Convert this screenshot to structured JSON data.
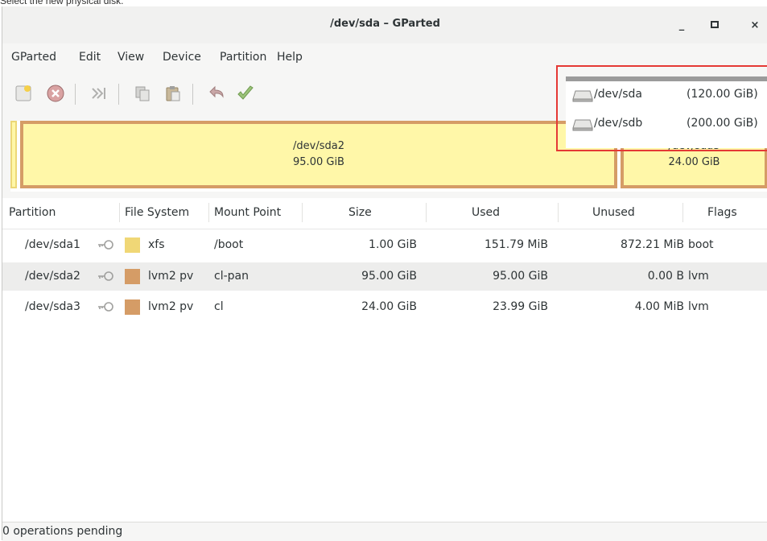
{
  "instruction": "Select the new physical disk.",
  "window": {
    "title": "/dev/sda – GParted",
    "minimize_label": "_",
    "maximize_label": "□",
    "close_label": "×"
  },
  "menu": [
    "GParted",
    "Edit",
    "View",
    "Device",
    "Partition",
    "Help"
  ],
  "toolbar": {
    "icons": [
      "new-partition-icon",
      "delete-icon",
      "resize-move-icon",
      "copy-icon",
      "paste-icon",
      "undo-icon",
      "apply-icon"
    ]
  },
  "disk_map": {
    "segments": [
      {
        "name": "/dev/sda2",
        "size": "95.00 GiB"
      },
      {
        "name": "/dev/sda3",
        "size": "24.00 GiB"
      }
    ],
    "colors": {
      "xfs": "#f0d776",
      "lvm": "#d59c66",
      "fill": "#fff7a8"
    }
  },
  "device_dropdown": {
    "items": [
      {
        "name": "/dev/sda",
        "size": "(120.00 GiB)"
      },
      {
        "name": "/dev/sdb",
        "size": "(200.00 GiB)"
      }
    ],
    "highlight_color": "#e53935"
  },
  "table": {
    "headers": [
      "Partition",
      "File System",
      "Mount Point",
      "Size",
      "Used",
      "Unused",
      "Flags"
    ],
    "rows": [
      {
        "partition": "/dev/sda1",
        "fs": "xfs",
        "fs_color": "#f0d776",
        "mount": "/boot",
        "size": "1.00 GiB",
        "used": "151.79 MiB",
        "unused": "872.21 MiB",
        "flags": "boot"
      },
      {
        "partition": "/dev/sda2",
        "fs": "lvm2 pv",
        "fs_color": "#d59c66",
        "mount": "cl-pan",
        "size": "95.00 GiB",
        "used": "95.00 GiB",
        "unused": "0.00 B",
        "flags": "lvm"
      },
      {
        "partition": "/dev/sda3",
        "fs": "lvm2 pv",
        "fs_color": "#d59c66",
        "mount": "cl",
        "size": "24.00 GiB",
        "used": "23.99 GiB",
        "unused": "4.00 MiB",
        "flags": "lvm"
      }
    ]
  },
  "status": "0 operations pending"
}
